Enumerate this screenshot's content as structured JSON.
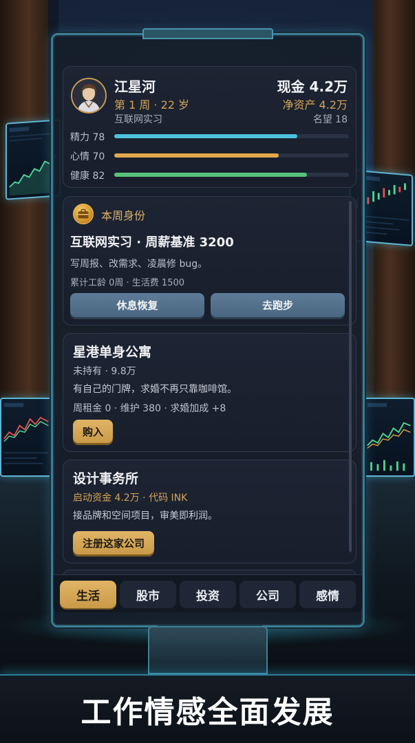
{
  "profile": {
    "name": "江星河",
    "week_age": "第 1 周 · 22 岁",
    "job": "互联网实习",
    "cash": "现金 4.2万",
    "net_worth": "净资产 4.2万",
    "reputation": "名望 18",
    "stats": [
      {
        "label": "精力 78",
        "value": 78,
        "color": "#4cc0dc"
      },
      {
        "label": "心情 70",
        "value": 70,
        "color": "#e2a84a"
      },
      {
        "label": "健康 82",
        "value": 82,
        "color": "#58c27a"
      }
    ]
  },
  "identity": {
    "section_title": "本周身份",
    "icon": "briefcase-icon",
    "headline": "互联网实习 · 周薪基准 3200",
    "description": "写周报、改需求、凌晨修 bug。",
    "meta": "累计工龄 0周 · 生活费 1500",
    "rest_button": "休息恢复",
    "run_button": "去跑步"
  },
  "apartment": {
    "title": "星港单身公寓",
    "status": "未持有 · 9.8万",
    "description": "有自己的门牌，求婚不再只靠咖啡馆。",
    "meta": "周租金 0 · 维护 380 · 求婚加成 +8",
    "buy_button": "购入"
  },
  "firm": {
    "title": "设计事务所",
    "capital": "启动资金 4.2万 · 代码 INK",
    "description": "接品牌和空间项目，审美即利润。",
    "register_button": "注册这家公司"
  },
  "tabs": [
    {
      "label": "生活",
      "active": true
    },
    {
      "label": "股市",
      "active": false
    },
    {
      "label": "投资",
      "active": false
    },
    {
      "label": "公司",
      "active": false
    },
    {
      "label": "感情",
      "active": false
    }
  ],
  "banner": {
    "text": "工作情感全面发展"
  },
  "colors": {
    "gold": "#d4a457",
    "accent_frame": "#3a7e95",
    "button_slate": "#5e7c98"
  }
}
